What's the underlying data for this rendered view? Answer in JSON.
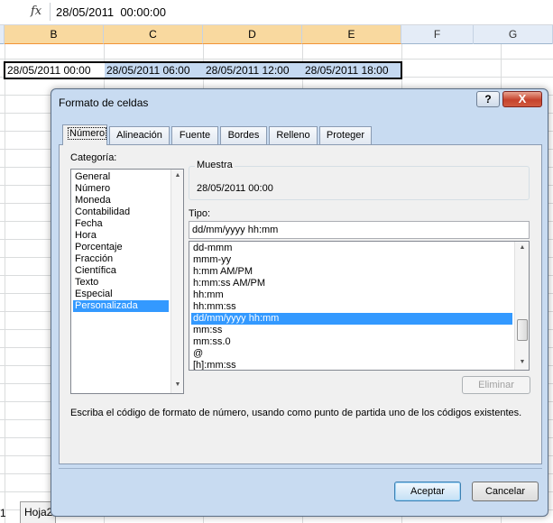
{
  "formula_bar": {
    "fx_symbol": "fx",
    "value": "28/05/2011  00:00:00"
  },
  "columns": [
    "B",
    "C",
    "D",
    "E",
    "F",
    "G"
  ],
  "cells": [
    "28/05/2011 00:00",
    "28/05/2011 06:00",
    "28/05/2011 12:00",
    "28/05/2011 18:00"
  ],
  "sheet_tabs": [
    "1",
    "Hoja2"
  ],
  "dialog": {
    "title": "Formato de celdas",
    "help_label": "?",
    "close_label": "X",
    "tabs": [
      "Número",
      "Alineación",
      "Fuente",
      "Bordes",
      "Relleno",
      "Proteger"
    ],
    "active_tab": "Número",
    "category_label": "Categoría:",
    "categories": [
      "General",
      "Número",
      "Moneda",
      "Contabilidad",
      "Fecha",
      "Hora",
      "Porcentaje",
      "Fracción",
      "Científica",
      "Texto",
      "Especial",
      "Personalizada"
    ],
    "selected_category": "Personalizada",
    "sample_label": "Muestra",
    "sample_value": "28/05/2011 00:00",
    "type_label": "Tipo:",
    "type_value": "dd/mm/yyyy hh:mm",
    "formats": [
      "dd-mmm",
      "mmm-yy",
      "h:mm AM/PM",
      "h:mm:ss AM/PM",
      "hh:mm",
      "hh:mm:ss",
      "dd/mm/yyyy hh:mm",
      "mm:ss",
      "mm:ss.0",
      "@",
      "[h]:mm:ss"
    ],
    "selected_format": "dd/mm/yyyy hh:mm",
    "delete_label": "Eliminar",
    "hint": "Escriba el código de formato de número, usando como punto de partida uno de los códigos existentes.",
    "ok_label": "Aceptar",
    "cancel_label": "Cancelar"
  },
  "colors": {
    "selection": "#3399ff",
    "dialog_frame": "#c8dbf1",
    "cell_highlight": "#c5d9f1"
  }
}
